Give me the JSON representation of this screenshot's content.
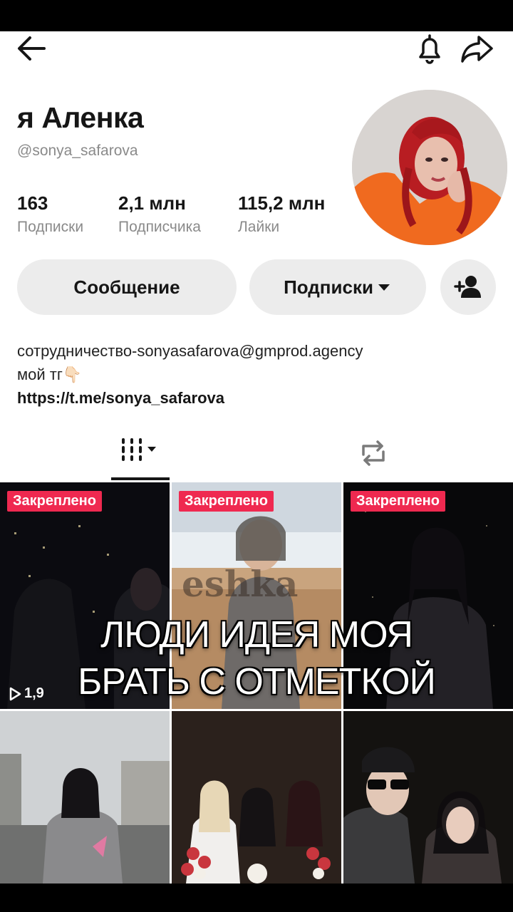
{
  "profile": {
    "name": "я Аленка",
    "handle": "@sonya_safarova"
  },
  "stats": {
    "following_value": "163",
    "following_label": "Подписки",
    "followers_value": "2,1 млн",
    "followers_label": "Подписчика",
    "likes_value": "115,2 млн",
    "likes_label": "Лайки"
  },
  "actions": {
    "message_label": "Сообщение",
    "subscriptions_label": "Подписки"
  },
  "bio": {
    "line1": "сотрудничество-sonyasafarova@gmprod.agency",
    "line2": "мой тг👇🏻",
    "link": "https://t.me/sonya_safarova"
  },
  "videos": {
    "pinned_label": "Закреплено",
    "views_first": "1,9"
  },
  "overlay": {
    "line1": "ЛЮДИ ИДЕЯ МОЯ",
    "line2": "БРАТЬ С ОТМЕТКОЙ"
  },
  "icons": [
    "back-arrow-icon",
    "bell-icon",
    "share-icon",
    "add-friend-icon",
    "grid-icon",
    "repost-icon",
    "play-icon",
    "caret-down-icon"
  ],
  "colors": {
    "pin_badge": "#ef2950",
    "pill_bg": "#ececec",
    "text_primary": "#161616",
    "text_secondary": "#8a8a8a"
  }
}
